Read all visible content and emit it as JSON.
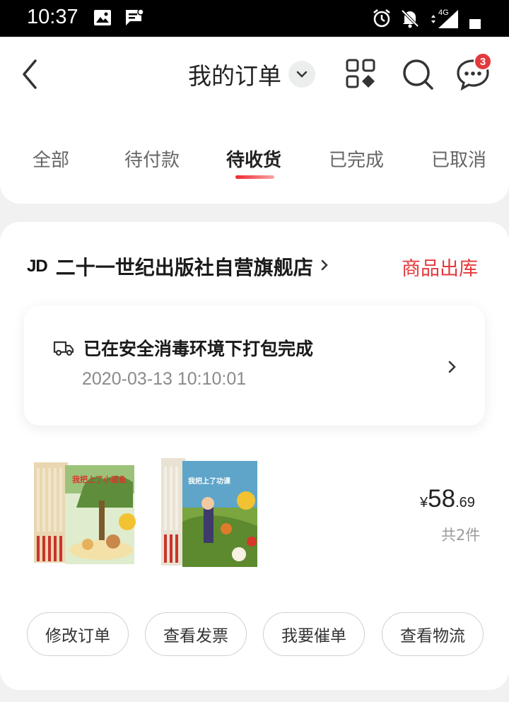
{
  "status_bar": {
    "time": "10:37",
    "network": "4G"
  },
  "header": {
    "title": "我的订单",
    "message_badge": "3"
  },
  "tabs": [
    {
      "label": "全部",
      "active": false
    },
    {
      "label": "待付款",
      "active": false
    },
    {
      "label": "待收货",
      "active": true
    },
    {
      "label": "已完成",
      "active": false
    },
    {
      "label": "已取消",
      "active": false
    }
  ],
  "order": {
    "shop_logo": "JD",
    "shop_name": "二十一世纪出版社自营旗舰店",
    "status": "商品出库",
    "logistics": {
      "message": "已在安全消毒环境下打包完成",
      "time": "2020-03-13 10:10:01"
    },
    "products": [
      {
        "cover_title": "我把上了小语鱼"
      },
      {
        "cover_title": "我把上了功课"
      }
    ],
    "price": {
      "symbol": "¥",
      "integer": "58",
      "decimal": ".69"
    },
    "count": "共2件",
    "actions": [
      "修改订单",
      "查看发票",
      "我要催单",
      "查看物流"
    ]
  },
  "colors": {
    "accent": "#e4393c",
    "background": "#f1f1f1"
  }
}
